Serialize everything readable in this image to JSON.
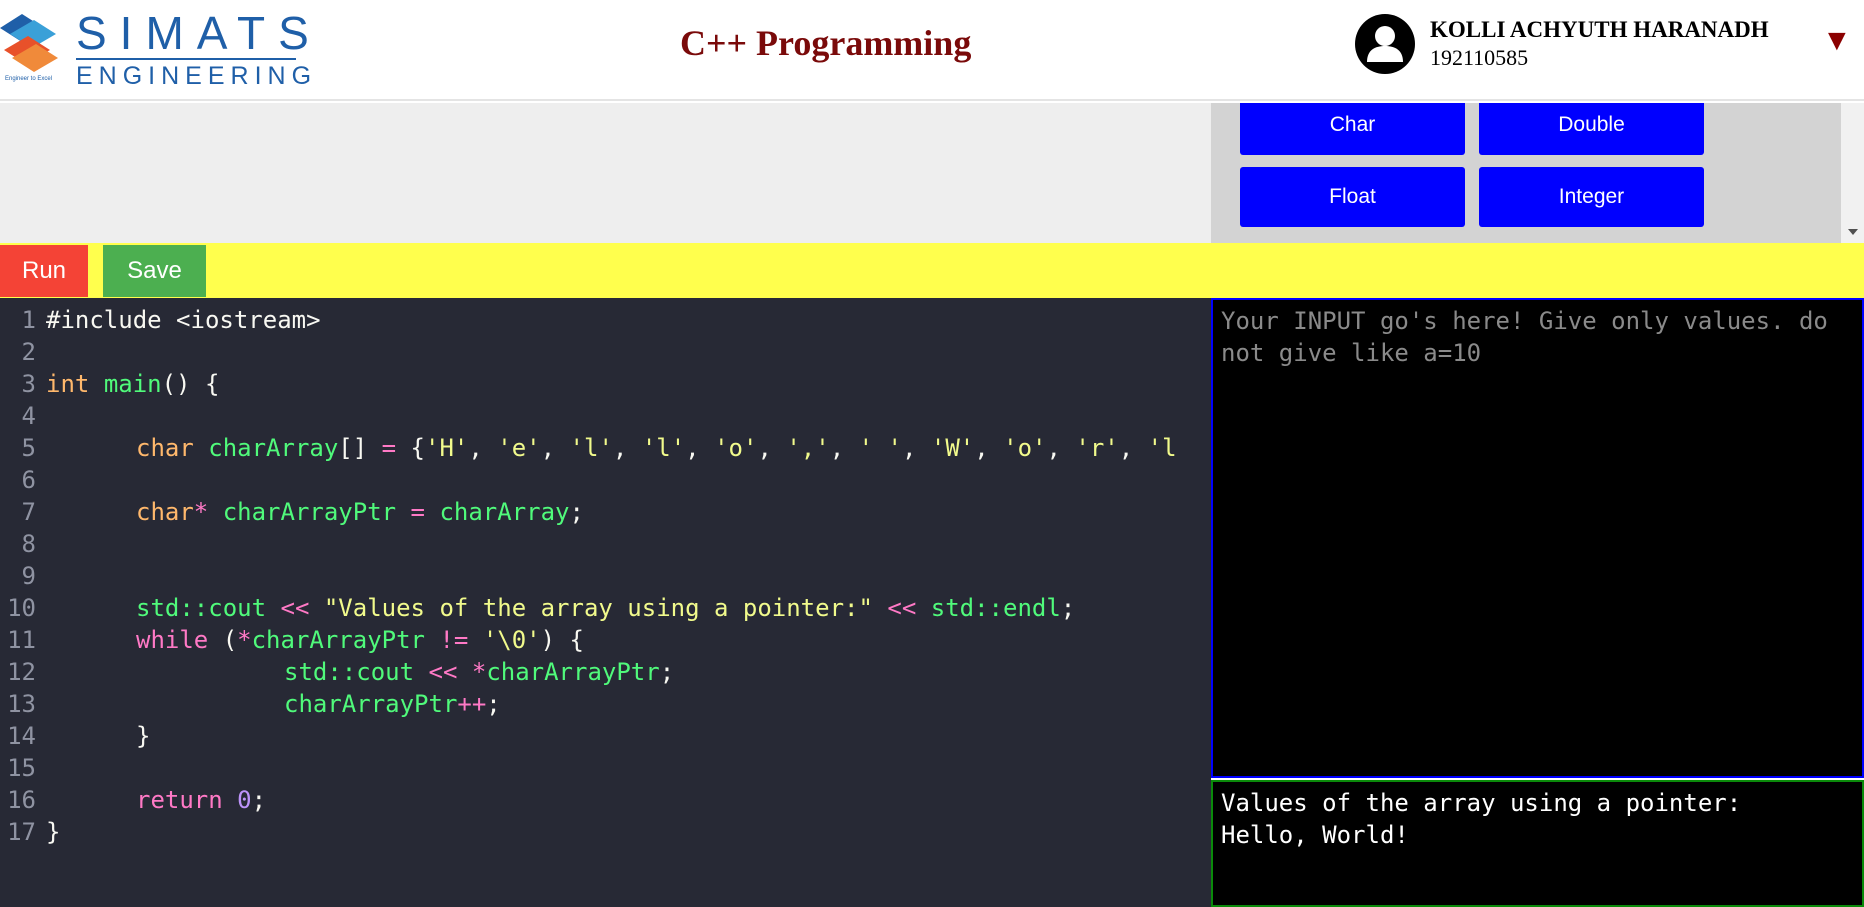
{
  "header": {
    "logo_text": "SIMATS",
    "logo_subtext": "ENGINEERING",
    "logo_tagline": "Engineer to Excel",
    "title": "C++ Programming",
    "user_name": "KOLLI ACHYUTH HARANADH",
    "user_id": "192110585",
    "menu_icon": "caret-down-icon",
    "avatar_icon": "user-avatar-icon"
  },
  "snippets": {
    "buttons": [
      "Char",
      "Double",
      "Float",
      "Integer"
    ]
  },
  "toolbar": {
    "run_label": "Run",
    "save_label": "Save"
  },
  "editor": {
    "line_numbers": [
      "1",
      "2",
      "3",
      "4",
      "5",
      "6",
      "7",
      "8",
      "9",
      "10",
      "11",
      "12",
      "13",
      "14",
      "15",
      "16",
      "17"
    ],
    "lines": [
      "#include <iostream>",
      "",
      "int main() {",
      "",
      "char charArray[] = {'H', 'e', 'l', 'l', 'o', ',', ' ', 'W', 'o', 'r', 'l",
      "",
      "char* charArrayPtr = charArray;",
      "",
      "",
      "std::cout << \"Values of the array using a pointer:\" << std::endl;",
      "while (*charArrayPtr != '\\0') {",
      "std::cout << *charArrayPtr;",
      "charArrayPtr++;",
      "}",
      "",
      "return 0;",
      "}"
    ]
  },
  "input": {
    "placeholder": "Your INPUT go's here! Give only values. do not give like a=10",
    "value": ""
  },
  "output": {
    "lines": [
      "Values of the array using a pointer:",
      "Hello, World!"
    ]
  },
  "colors": {
    "brand_blue": "#1f5fa8",
    "title_red": "#7a0a0a",
    "snippet_button": "#0000ff",
    "run_button": "#f44336",
    "save_button": "#4caf50",
    "toolbar": "#ffff4d",
    "editor_bg": "#272935"
  }
}
